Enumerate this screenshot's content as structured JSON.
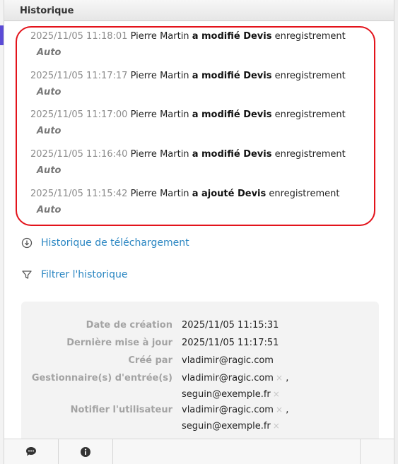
{
  "panel": {
    "title": "Historique"
  },
  "history": [
    {
      "timestamp": "2025/11/05 11:18:01",
      "user": "Pierre Martin",
      "action": "a modifié Devis",
      "tail": "enregistrement",
      "source": "Auto"
    },
    {
      "timestamp": "2025/11/05 11:17:17",
      "user": "Pierre Martin",
      "action": "a modifié Devis",
      "tail": "enregistrement",
      "source": "Auto"
    },
    {
      "timestamp": "2025/11/05 11:17:00",
      "user": "Pierre Martin",
      "action": "a modifié Devis",
      "tail": "enregistrement",
      "source": "Auto"
    },
    {
      "timestamp": "2025/11/05 11:16:40",
      "user": "Pierre Martin",
      "action": "a modifié Devis",
      "tail": "enregistrement",
      "source": "Auto"
    },
    {
      "timestamp": "2025/11/05 11:15:42",
      "user": "Pierre Martin",
      "action": "a ajouté Devis",
      "tail": "enregistrement",
      "source": "Auto"
    }
  ],
  "links": {
    "download_history": "Historique de téléchargement",
    "filter_history": "Filtrer l'historique"
  },
  "meta": {
    "created_label": "Date de création",
    "created_value": "2025/11/05 11:15:31",
    "updated_label": "Dernière mise à jour",
    "updated_value": "2025/11/05 11:17:51",
    "created_by_label": "Créé par",
    "created_by_value": "vladimir@ragic.com",
    "managers_label": "Gestionnaire(s) d'entrée(s)",
    "managers": [
      "vladimir@ragic.com",
      "seguin@exemple.fr"
    ],
    "notify_label": "Notifier l'utilisateur",
    "notify": [
      "vladimir@ragic.com",
      "seguin@exemple.fr"
    ],
    "separator": ","
  },
  "icons": {
    "remove": "×",
    "comment": "comment-icon",
    "info": "info-icon"
  },
  "colors": {
    "highlight": "#e3131b",
    "link": "#2a86c2"
  }
}
